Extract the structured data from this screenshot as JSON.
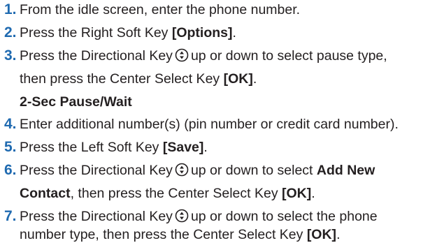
{
  "steps": [
    {
      "number": "1.",
      "text": "From the idle screen, enter the phone number."
    },
    {
      "number": "2.",
      "pre": "Press the Right Soft Key ",
      "key": "[Options]",
      "post": "."
    },
    {
      "number": "3.",
      "pre": "Press the Directional Key",
      "post": "up or down to select pause type,",
      "cont_pre": "then press the Center Select Key ",
      "cont_key": "[OK]",
      "cont_post": ".",
      "sub": "2-Sec Pause/Wait"
    },
    {
      "number": "4.",
      "text": "Enter additional number(s) (pin number or credit card number)."
    },
    {
      "number": "5.",
      "pre": "Press the Left Soft Key ",
      "key": "[Save]",
      "post": "."
    },
    {
      "number": "6.",
      "pre": "Press the Directional Key",
      "mid": "up or down to select ",
      "bold": "Add New",
      "cont_bold": "Contact",
      "cont_pre": ", then press the Center Select Key ",
      "cont_key": "[OK]",
      "cont_post": "."
    },
    {
      "number": "7.",
      "pre": "Press the Directional Key",
      "post": "up or down to select the phone",
      "cont_pre": "number type, then press the Center Select Key ",
      "cont_key": "[OK]",
      "cont_post": "."
    }
  ],
  "icons": {
    "directional_key": "directional-key-icon"
  },
  "colors": {
    "step_number": "#1f6ab0",
    "text": "#231f20"
  }
}
